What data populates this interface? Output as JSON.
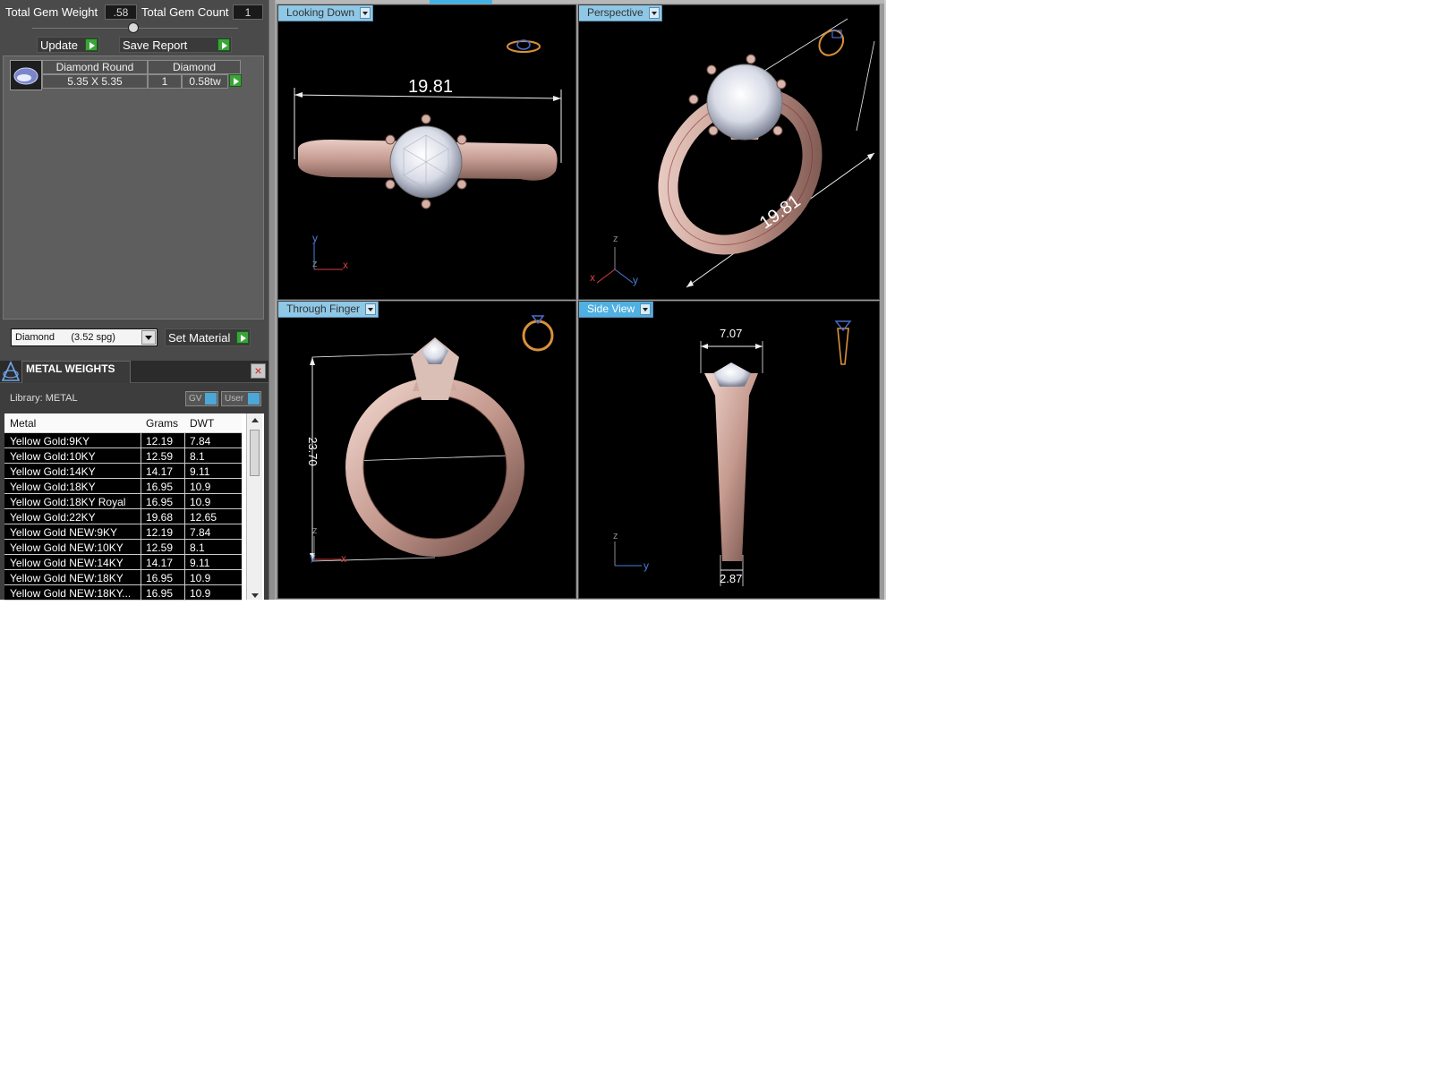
{
  "gem_summary": {
    "total_weight_label": "Total Gem Weight",
    "total_weight_value": ".58",
    "total_count_label": "Total Gem Count",
    "total_count_value": "1",
    "update_label": "Update",
    "save_report_label": "Save Report"
  },
  "gem_list": {
    "shape_header": "Diamond Round",
    "material_header": "Diamond",
    "size": "5.35 X 5.35",
    "count": "1",
    "weight": "0.58tw"
  },
  "material": {
    "selected": "Diamond      (3.52 spg)",
    "set_label": "Set Material"
  },
  "metal_weights": {
    "title": "METAL WEIGHTS",
    "library_label": "Library: METAL",
    "gv_label": "GV",
    "user_label": "User",
    "columns": [
      "Metal",
      "Grams",
      "DWT"
    ],
    "rows": [
      {
        "metal": "Yellow Gold:9KY",
        "grams": "12.19",
        "dwt": "7.84"
      },
      {
        "metal": "Yellow Gold:10KY",
        "grams": "12.59",
        "dwt": "8.1"
      },
      {
        "metal": "Yellow Gold:14KY",
        "grams": "14.17",
        "dwt": "9.11"
      },
      {
        "metal": "Yellow Gold:18KY",
        "grams": "16.95",
        "dwt": "10.9"
      },
      {
        "metal": "Yellow Gold:18KY Royal",
        "grams": "16.95",
        "dwt": "10.9"
      },
      {
        "metal": "Yellow Gold:22KY",
        "grams": "19.68",
        "dwt": "12.65"
      },
      {
        "metal": "Yellow Gold NEW:9KY",
        "grams": "12.19",
        "dwt": "7.84"
      },
      {
        "metal": "Yellow Gold NEW:10KY",
        "grams": "12.59",
        "dwt": "8.1"
      },
      {
        "metal": "Yellow Gold NEW:14KY",
        "grams": "14.17",
        "dwt": "9.11"
      },
      {
        "metal": "Yellow Gold NEW:18KY",
        "grams": "16.95",
        "dwt": "10.9"
      },
      {
        "metal": "Yellow Gold NEW:18KY...",
        "grams": "16.95",
        "dwt": "10.9"
      }
    ]
  },
  "viewports": {
    "top_left": {
      "tab": "Looking Down",
      "dimension": "19.81",
      "axis_a": "y",
      "axis_b": "z",
      "axis_c": "x"
    },
    "top_right": {
      "tab": "Perspective",
      "dimension": "19.81",
      "axis_a": "z",
      "axis_b": "x",
      "axis_c": "y"
    },
    "bottom_left": {
      "tab": "Through Finger",
      "dimension": "23.70",
      "axis_a": "z",
      "axis_b": "y",
      "axis_c": "x"
    },
    "bottom_right": {
      "tab": "Side View",
      "dimension_top": "7.07",
      "dimension_bottom": "2.87",
      "axis_a": "z",
      "axis_b": "y"
    }
  },
  "colors": {
    "metal": "#c9a39a",
    "viewport_tab": "#8fc8e6",
    "viewport_tab_active": "#4fb0e2",
    "play_button": "#3aa43a"
  }
}
